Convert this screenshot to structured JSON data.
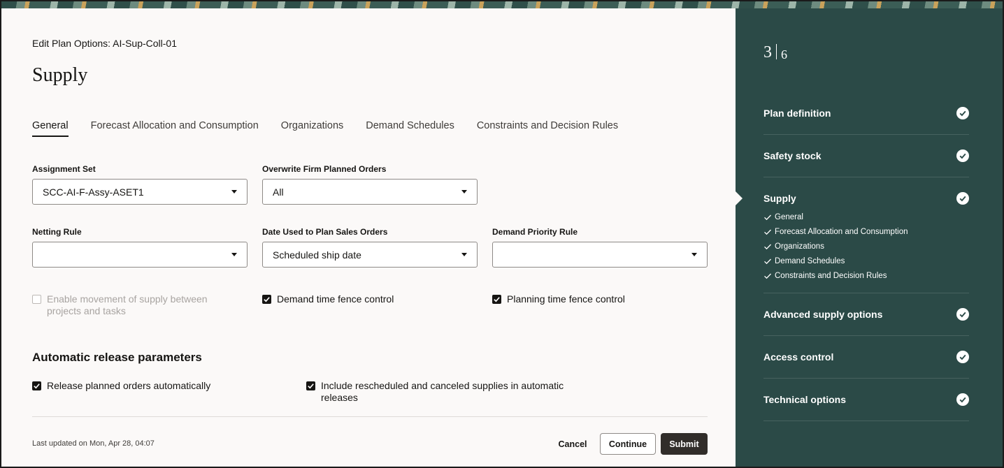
{
  "header": {
    "breadcrumb": "Edit Plan Options: AI-Sup-Coll-01",
    "title": "Supply"
  },
  "tabs": [
    {
      "label": "General",
      "active": true
    },
    {
      "label": "Forecast Allocation and Consumption"
    },
    {
      "label": "Organizations"
    },
    {
      "label": "Demand Schedules"
    },
    {
      "label": "Constraints and Decision Rules"
    }
  ],
  "fields": {
    "assignment_set": {
      "label": "Assignment Set",
      "value": "SCC-AI-F-Assy-ASET1"
    },
    "overwrite_firm": {
      "label": "Overwrite Firm Planned Orders",
      "value": "All"
    },
    "netting_rule": {
      "label": "Netting Rule",
      "value": ""
    },
    "date_used": {
      "label": "Date Used to Plan Sales Orders",
      "value": "Scheduled ship date"
    },
    "demand_priority": {
      "label": "Demand Priority Rule",
      "value": ""
    }
  },
  "checkboxes": {
    "enable_movement": {
      "label": "Enable movement of supply between projects and tasks",
      "checked": false,
      "disabled": true
    },
    "demand_fence": {
      "label": "Demand time fence control",
      "checked": true
    },
    "planning_fence": {
      "label": "Planning time fence control",
      "checked": true
    }
  },
  "release": {
    "title": "Automatic release parameters",
    "release_auto": {
      "label": "Release planned orders automatically",
      "checked": true
    },
    "include_resched": {
      "label": "Include rescheduled and canceled supplies in automatic releases",
      "checked": true
    }
  },
  "footer": {
    "updated": "Last updated on Mon, Apr 28, 04:07",
    "cancel": "Cancel",
    "continue": "Continue",
    "submit": "Submit"
  },
  "side": {
    "current_step": "3",
    "total_steps": "6",
    "steps": [
      {
        "label": "Plan definition",
        "complete": true
      },
      {
        "label": "Safety stock",
        "complete": true
      },
      {
        "label": "Supply",
        "complete": true,
        "current": true,
        "substeps": [
          "General",
          "Forecast Allocation and Consumption",
          "Organizations",
          "Demand Schedules",
          "Constraints and Decision Rules"
        ]
      },
      {
        "label": "Advanced supply options",
        "complete": true
      },
      {
        "label": "Access control",
        "complete": true
      },
      {
        "label": "Technical options",
        "complete": true
      }
    ]
  },
  "colors": {
    "panel": "#2b4a47",
    "primary_button": "#312d2a",
    "page_bg": "#fbf9f8"
  }
}
